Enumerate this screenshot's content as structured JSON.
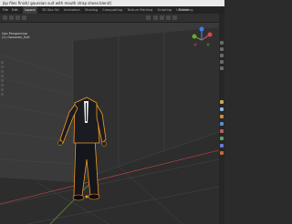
{
  "window": {
    "title": "jkp files finish/ gaussian suit with mouth strap shoes.blend]"
  },
  "menus": [
    "File",
    "Edit"
  ],
  "workspaces": [
    {
      "label": "Layout",
      "active": true
    },
    {
      "label": "3D Sea Ski"
    },
    {
      "label": "Animation"
    },
    {
      "label": "Shading"
    },
    {
      "label": "Compositing"
    },
    {
      "label": "Texture Painting"
    },
    {
      "label": "Scripting"
    },
    {
      "label": "UV Editing"
    }
  ],
  "scene": {
    "label": "Scene"
  },
  "viewport": {
    "object_label": "(1) Gaussian_Suit",
    "view_label": "Use Perspective"
  },
  "colors": {
    "selection_outline": "#f39a22",
    "axis_x": "#d5474e",
    "axis_y": "#6ea52c",
    "axis_z": "#3f7ee6",
    "grid": "#3a3a3a"
  },
  "right_toolbar": {
    "icons": [
      "cursor-icon",
      "move-icon",
      "orbit-icon",
      "camera-icon",
      "grid-icon",
      "render-icon",
      "material-icon",
      "object-icon",
      "modifier-icon",
      "particles-icon",
      "physics-icon",
      "constraint-icon",
      "data-icon"
    ]
  }
}
